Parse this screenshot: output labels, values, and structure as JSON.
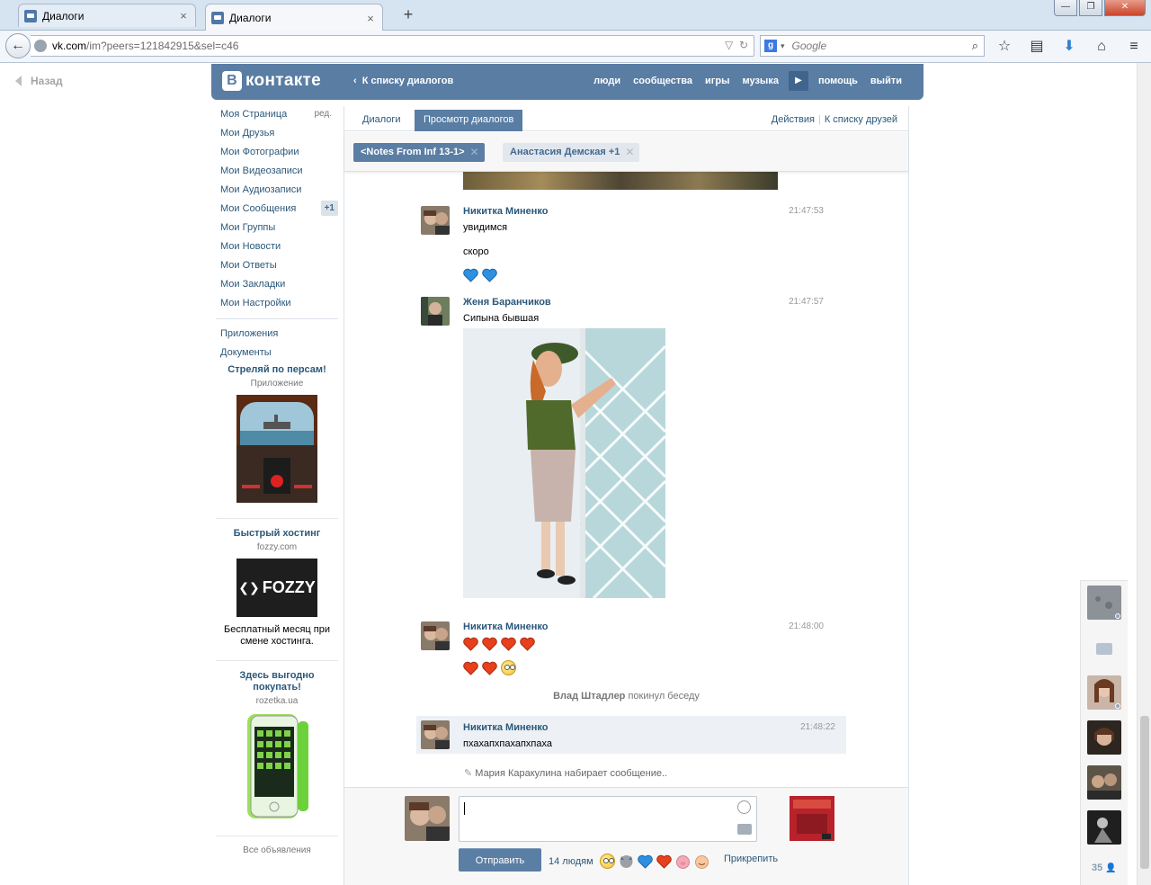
{
  "browser": {
    "tabs": [
      {
        "title": "Диалоги",
        "active": false
      },
      {
        "title": "Диалоги",
        "active": true
      }
    ],
    "url_host": "vk.com",
    "url_path": "/im?peers=121842915&sel=c46",
    "search_placeholder": "Google",
    "close_glyph": "×",
    "newtab_glyph": "+"
  },
  "page": {
    "back_label": "Назад"
  },
  "header": {
    "logo_text": "контакте",
    "logo_letter": "B",
    "back_to_list": "К списку диалогов",
    "nav": [
      "люди",
      "сообщества",
      "игры",
      "музыка",
      "помощь",
      "выйти"
    ]
  },
  "sidebar": {
    "items": [
      {
        "label": "Моя Страница",
        "aside": "ред."
      },
      {
        "label": "Мои Друзья"
      },
      {
        "label": "Мои Фотографии"
      },
      {
        "label": "Мои Видеозаписи"
      },
      {
        "label": "Мои Аудиозаписи"
      },
      {
        "label": "Мои Сообщения",
        "badge": "+1"
      },
      {
        "label": "Мои Группы"
      },
      {
        "label": "Мои Новости"
      },
      {
        "label": "Мои Ответы"
      },
      {
        "label": "Мои Закладки"
      },
      {
        "label": "Мои Настройки"
      }
    ],
    "extra": [
      "Приложения",
      "Документы"
    ]
  },
  "ads": [
    {
      "title": "Стреляй по персам!",
      "sub": "Приложение"
    },
    {
      "title": "Быстрый хостинг",
      "sub": "fozzy.com",
      "logo_text": "FOZZY",
      "desc": "Бесплатный месяц при смене хостинга."
    },
    {
      "title": "Здесь выгодно покупать!",
      "sub": "rozetka.ua"
    }
  ],
  "ads_all": "Все объявления",
  "im": {
    "tabs": [
      "Диалоги",
      "Просмотр диалогов"
    ],
    "actions": "Действия",
    "friends_link": "К списку друзей",
    "chats": [
      "<Notes From Inf 13-1>",
      "Анастасия Демская +1"
    ],
    "messages": [
      {
        "author": "Никитка Миненко",
        "time": "21:47:53",
        "lines": [
          "увидимся",
          "скоро"
        ]
      },
      {
        "author": "Женя Баранчиков",
        "time": "21:47:57",
        "lines": [
          "Сипына бывшая"
        ]
      },
      {
        "author": "Никитка Миненко",
        "time": "21:48:00"
      },
      {
        "author": "Никитка Миненко",
        "time": "21:48:22",
        "lines": [
          "пхахапхпахапхпаха"
        ]
      }
    ],
    "left_note_name": "Влад Штадлер",
    "left_note_text": "покинул беседу",
    "typing": "Мария Каракулина набирает сообщение..",
    "send": "Отправить",
    "quick_count": "14 людям",
    "attach": "Прикрепить"
  },
  "chatbar": {
    "count": "35"
  },
  "colors": {
    "vk_blue": "#597da3",
    "link": "#2b587a",
    "heart_red": "#e8401c",
    "heart_blue": "#2f8fe0"
  }
}
